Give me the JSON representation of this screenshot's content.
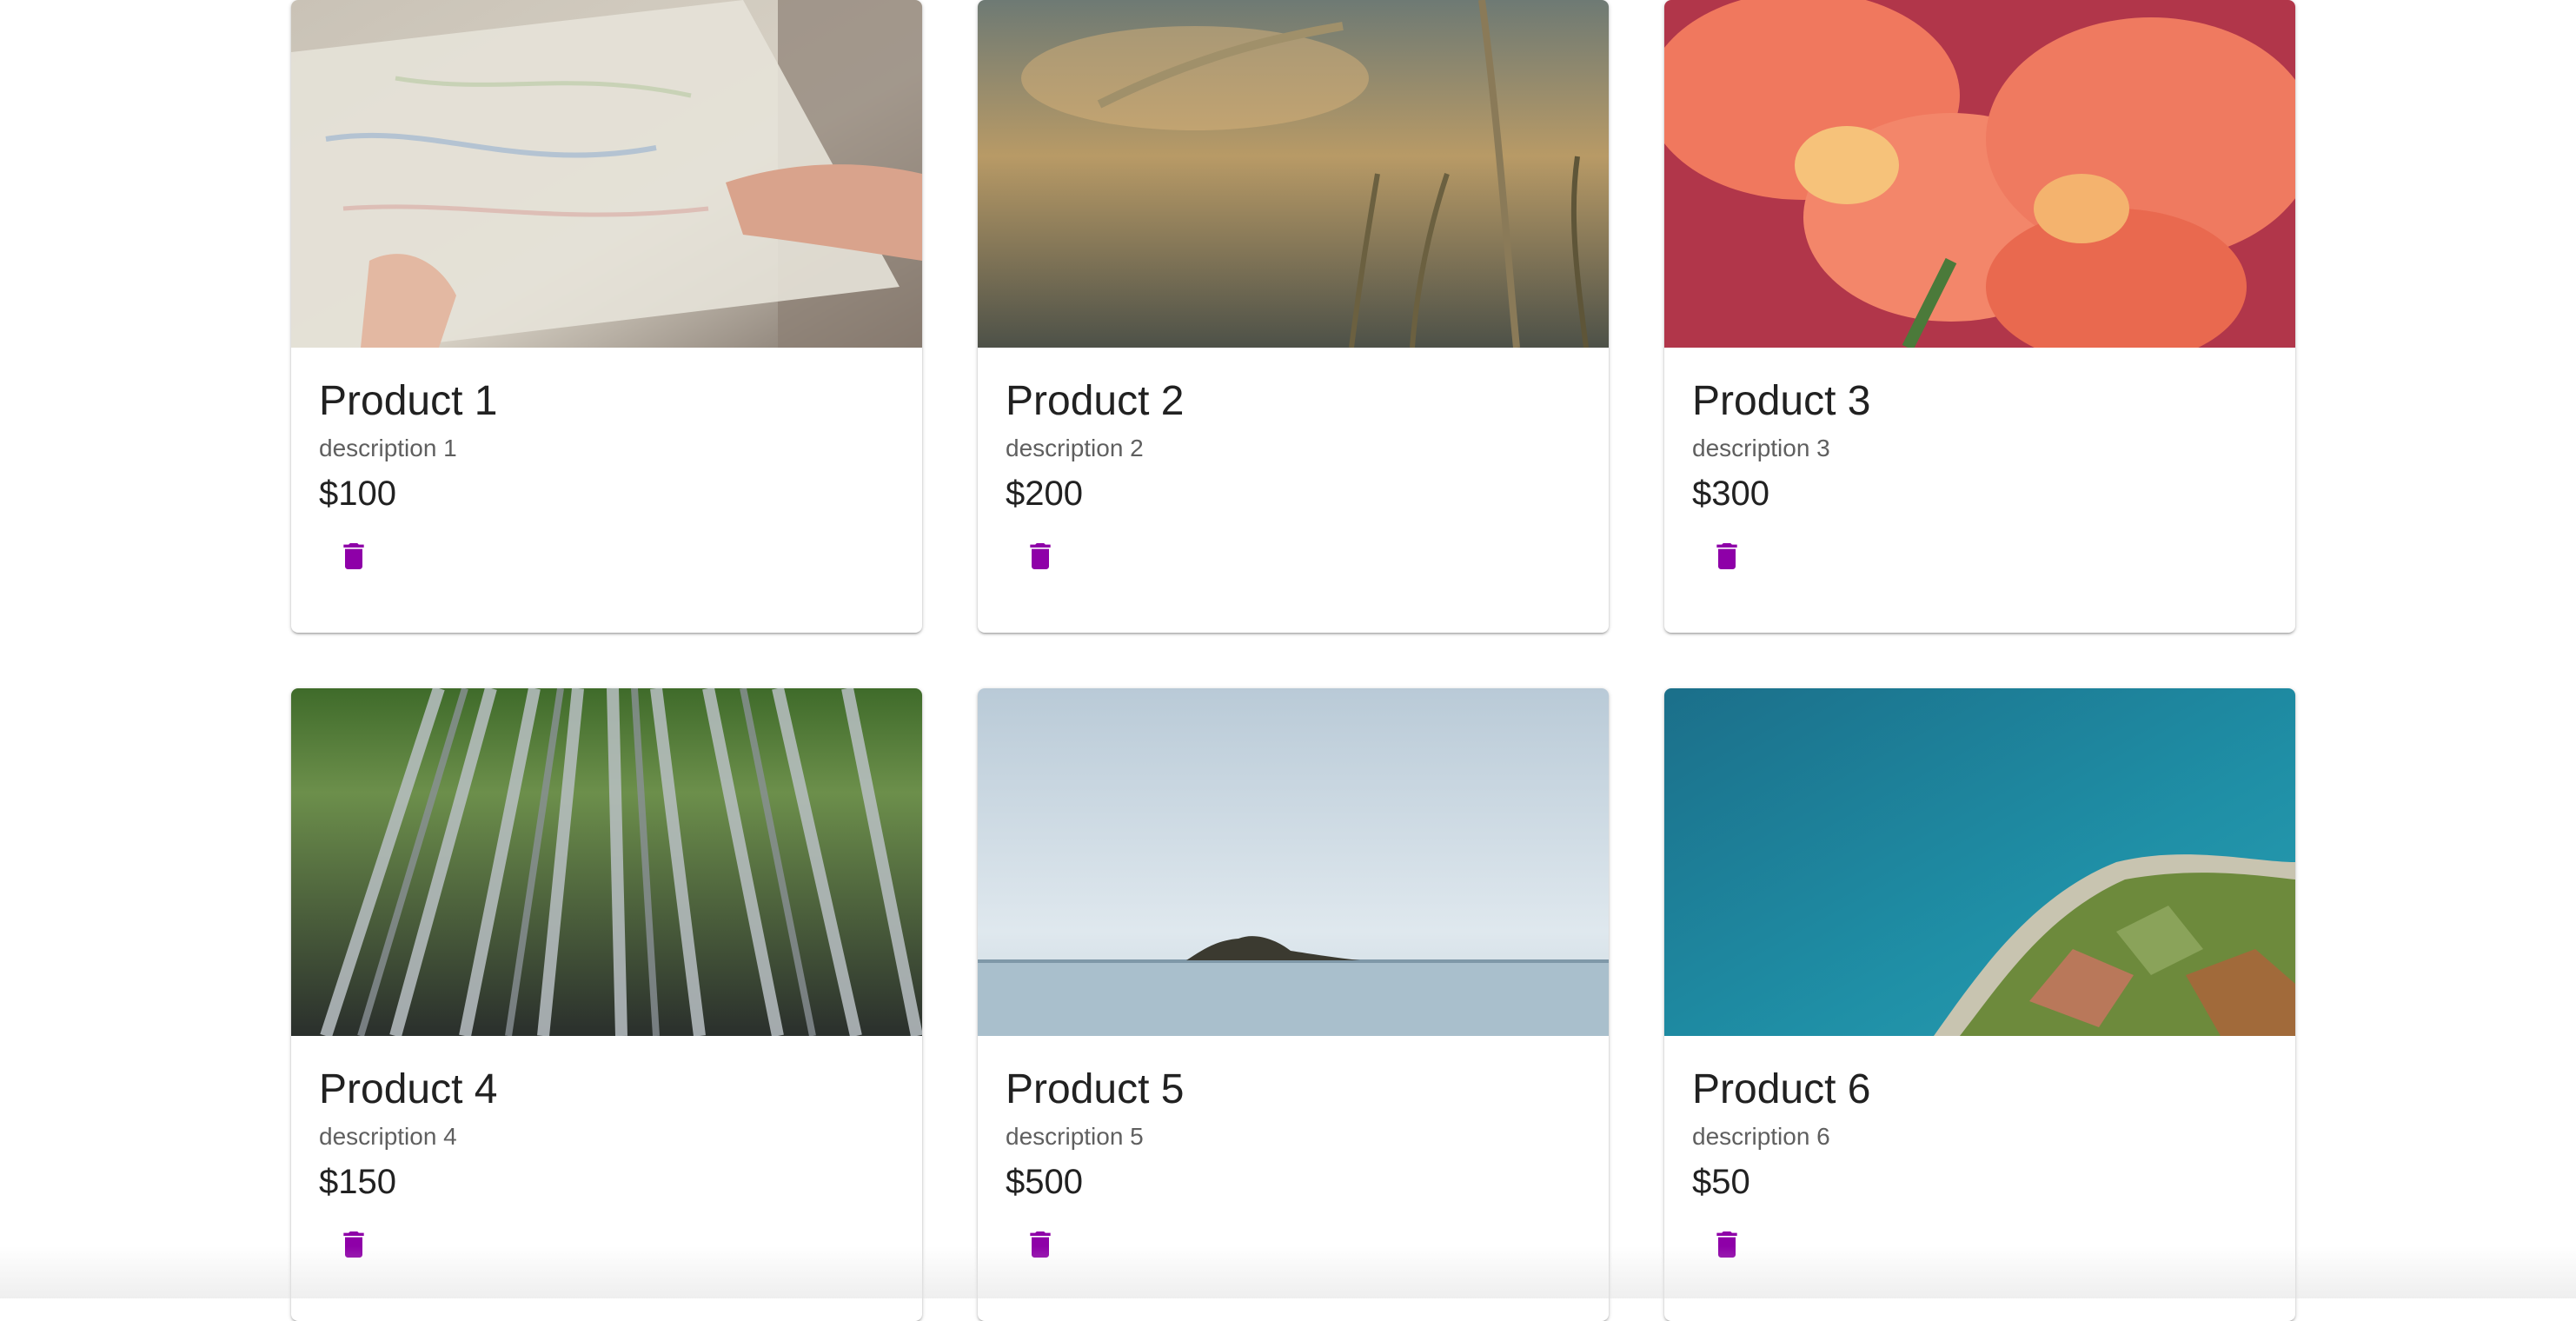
{
  "accent_color": "#8e00a8",
  "products": [
    {
      "title": "Product 1",
      "description": "description 1",
      "price": "$100",
      "image": "map-photo",
      "delete_icon": "trash-icon"
    },
    {
      "title": "Product 2",
      "description": "description 2",
      "price": "$200",
      "image": "wheat-field-photo",
      "delete_icon": "trash-icon"
    },
    {
      "title": "Product 3",
      "description": "description 3",
      "price": "$300",
      "image": "lily-flowers-photo",
      "delete_icon": "trash-icon"
    },
    {
      "title": "Product 4",
      "description": "description 4",
      "price": "$150",
      "image": "bamboo-forest-photo",
      "delete_icon": "trash-icon"
    },
    {
      "title": "Product 5",
      "description": "description 5",
      "price": "$500",
      "image": "island-sea-photo",
      "delete_icon": "trash-icon"
    },
    {
      "title": "Product 6",
      "description": "description 6",
      "price": "$50",
      "image": "coastline-aerial-photo",
      "delete_icon": "trash-icon"
    }
  ]
}
